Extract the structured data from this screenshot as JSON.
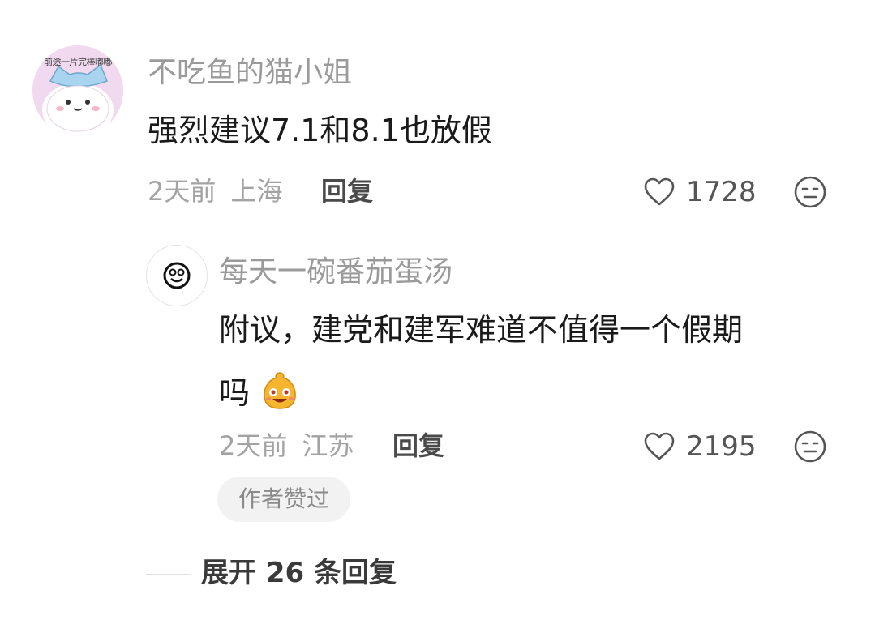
{
  "comment": {
    "avatar_banner": "前途一片完棒嘟嘟",
    "username": "不吃鱼的猫小姐",
    "content": "强烈建议7.1和8.1也放假",
    "time": "2天前",
    "location": "上海",
    "reply_label": "回复",
    "like_count": "1728",
    "like_icon": "heart-outline-icon",
    "dislike_icon": "neutral-face-icon"
  },
  "reply": {
    "avatar_icon": "smiley-face-icon",
    "username": "每天一碗番茄蛋汤",
    "content_line1": "附议，建党和建军难道不值得一个假期",
    "content_line2": "吗",
    "emoji_icon": "happy-blush-emoji-icon",
    "time": "2天前",
    "location": "江苏",
    "reply_label": "回复",
    "like_count": "2195",
    "like_icon": "heart-outline-icon",
    "dislike_icon": "neutral-face-icon",
    "author_badge": "作者赞过"
  },
  "expand": {
    "label": "展开 26 条回复"
  },
  "colors": {
    "username": "#9a9a9a",
    "meta": "#a3a3a3",
    "text": "#1a1a1a",
    "badge_bg": "#f2f2f2",
    "avatar_bg": "#f1d9f0"
  }
}
